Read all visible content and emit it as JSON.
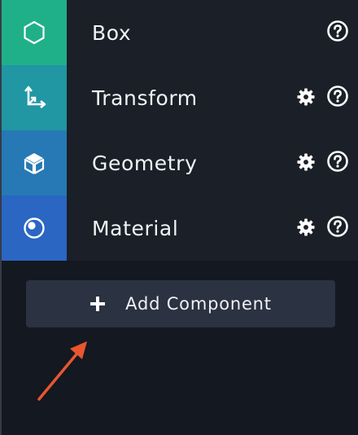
{
  "components": [
    {
      "label": "Box",
      "icon": "hexagon-icon",
      "color": "#1fb08a",
      "has_settings": false
    },
    {
      "label": "Transform",
      "icon": "transform-axes-icon",
      "color": "#2097a2",
      "has_settings": true
    },
    {
      "label": "Geometry",
      "icon": "cube-icon",
      "color": "#2679b4",
      "has_settings": true
    },
    {
      "label": "Material",
      "icon": "material-sphere-icon",
      "color": "#2a66c2",
      "has_settings": true
    }
  ],
  "add_button": {
    "label": "Add Component",
    "icon": "plus-icon"
  },
  "annotation": {
    "icon": "arrow-icon",
    "color": "#e8562f"
  },
  "colors": {
    "background": "#141820",
    "row_background": "#1b1f28",
    "button_background": "#2b3241",
    "text": "#f1f3f6"
  }
}
